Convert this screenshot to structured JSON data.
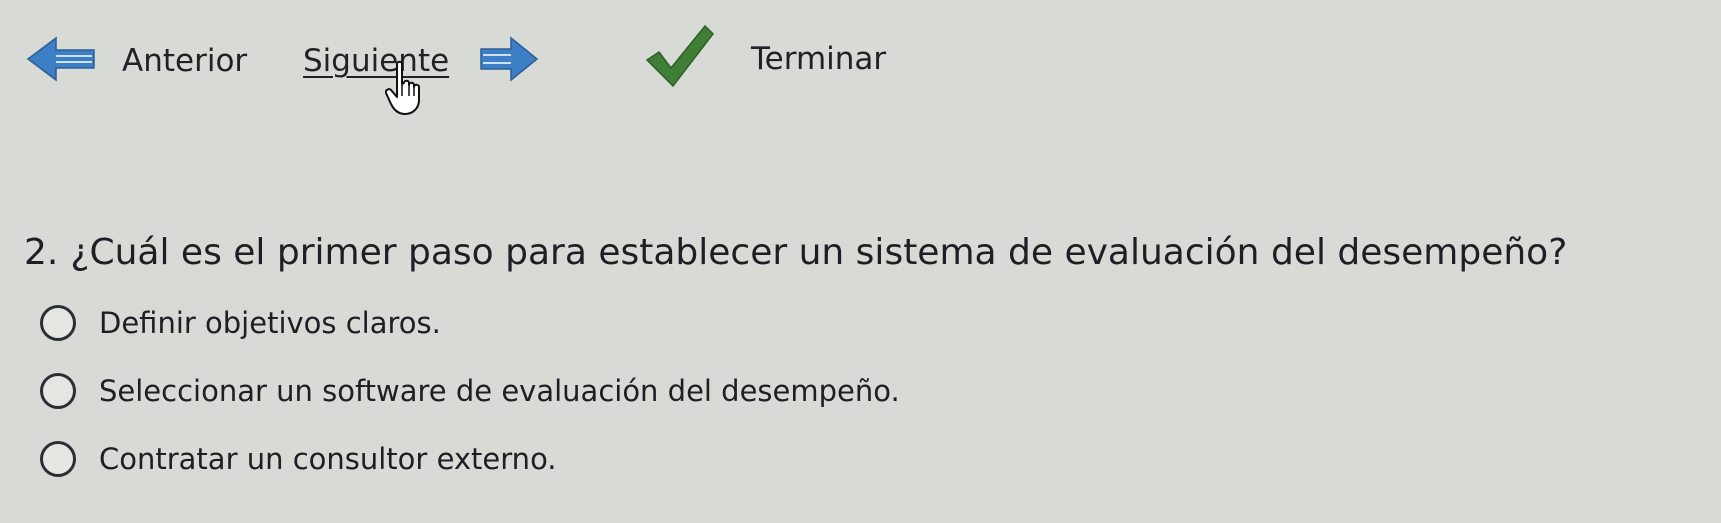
{
  "nav": {
    "previous_label": "Anterior",
    "next_label": "Siguiente",
    "finish_label": "Terminar"
  },
  "question": {
    "number": "2.",
    "text": "¿Cuál es el primer paso para establecer un sistema de evaluación del desempeño?",
    "options": [
      {
        "label": "Definir objetivos claros.",
        "selected": false
      },
      {
        "label": "Seleccionar un software de evaluación del desempeño.",
        "selected": false
      },
      {
        "label": "Contratar un consultor externo.",
        "selected": false
      }
    ]
  },
  "icons": {
    "previous": "arrow-left-icon",
    "next": "arrow-right-icon",
    "finish": "checkmark-icon",
    "pointer": "hand-pointer-icon"
  },
  "colors": {
    "background": "#d8dad6",
    "arrow_blue": "#3d7fc4",
    "check_green": "#3f7f35"
  }
}
